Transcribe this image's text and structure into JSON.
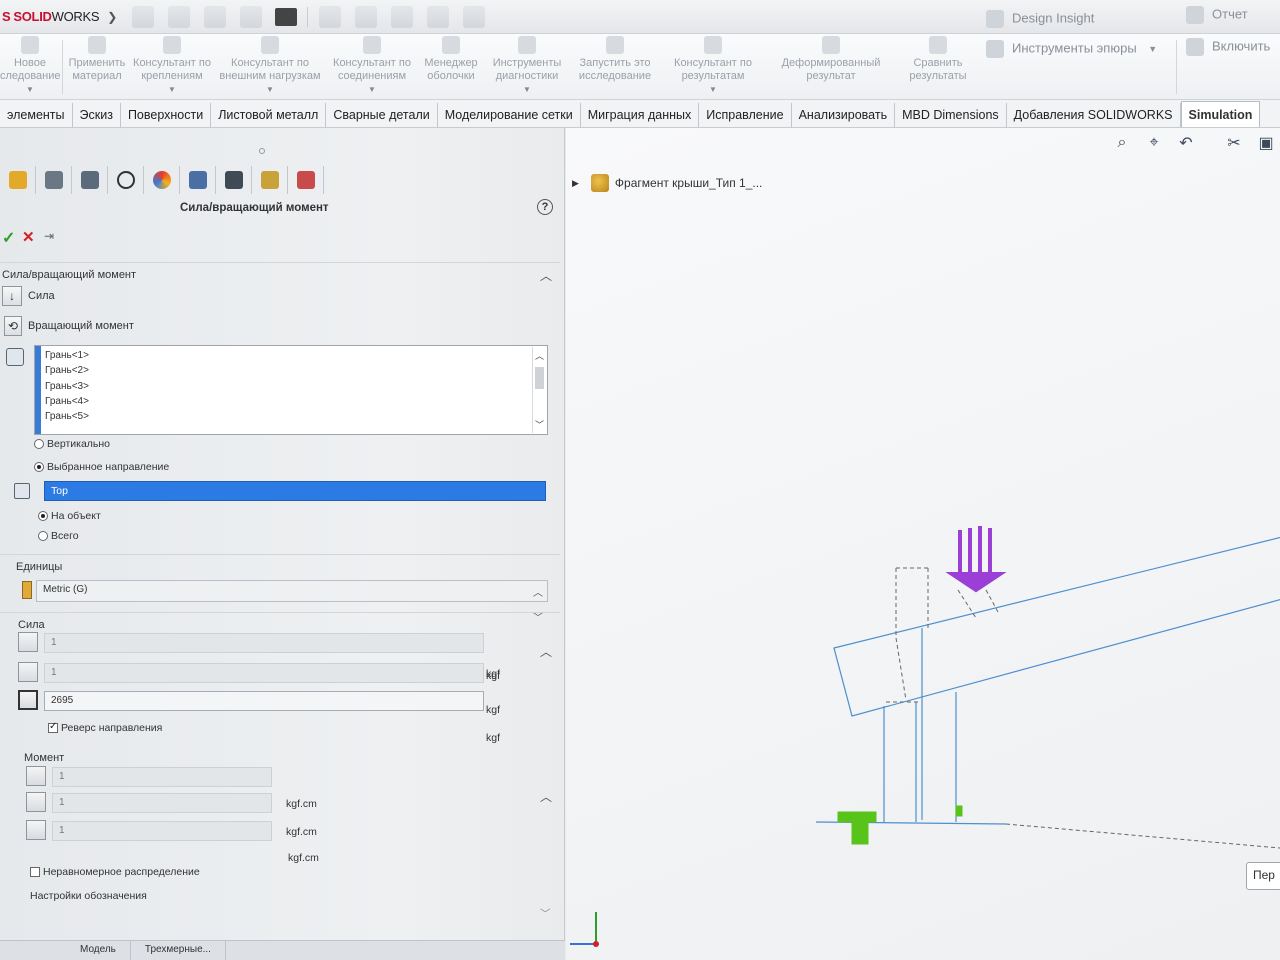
{
  "app": {
    "brand_prefix": "S",
    "brand_solid": "SOLID",
    "brand_works": "WORKS"
  },
  "ribbon": {
    "items": [
      {
        "label": "Новое\nследование"
      },
      {
        "label": "Применить\nматериал"
      },
      {
        "label": "Консультант по\nкреплениям"
      },
      {
        "label": "Консультант по\nвнешним нагрузкам"
      },
      {
        "label": "Консультант по\nсоединениям"
      },
      {
        "label": "Менеджер\nоболочки"
      },
      {
        "label": "Инструменты\nдиагностики"
      },
      {
        "label": "Запустить это\nисследование"
      },
      {
        "label": "Консультант по\nрезультатам"
      },
      {
        "label": "Деформированный\nрезультат"
      },
      {
        "label": "Сравнить\nрезультаты"
      }
    ],
    "design_insight": "Design Insight",
    "plot_tools": "Инструменты эпюры",
    "report": "Отчет",
    "include": "Включить"
  },
  "tabs": [
    {
      "label": "элементы"
    },
    {
      "label": "Эскиз"
    },
    {
      "label": "Поверхности"
    },
    {
      "label": "Листовой металл"
    },
    {
      "label": "Сварные детали"
    },
    {
      "label": "Моделирование сетки"
    },
    {
      "label": "Миграция данных"
    },
    {
      "label": "Исправление"
    },
    {
      "label": "Анализировать"
    },
    {
      "label": "MBD Dimensions"
    },
    {
      "label": "Добавления SOLIDWORKS"
    },
    {
      "label": "Simulation"
    }
  ],
  "property_manager": {
    "title": "Сила/вращающий момент",
    "help": "?",
    "group_force_torque": "Сила/вращающий момент",
    "opt_force": "Сила",
    "opt_torque": "Вращающий момент",
    "faces": [
      "Грань<1>",
      "Грань<2>",
      "Грань<3>",
      "Грань<4>",
      "Грань<5>"
    ],
    "radio_normal": "Вертикально",
    "radio_selected_dir": "Выбранное направление",
    "direction_ref": "Top",
    "radio_per_item": "На объект",
    "radio_total": "Всего",
    "units_label": "Единицы",
    "units_value": "Metric (G)",
    "force_label": "Сила",
    "force_fields": [
      {
        "value": "1",
        "unit": "kgf"
      },
      {
        "value": "1",
        "unit": "kgf"
      },
      {
        "value": "2695",
        "unit": "kgf"
      }
    ],
    "reverse_direction": "Реверс направления",
    "reverse_unit": "kgf",
    "moment_label": "Момент",
    "moment_fields": [
      {
        "value": "1",
        "unit": "kgf.cm"
      },
      {
        "value": "1",
        "unit": "kgf.cm"
      },
      {
        "value": "1",
        "unit": "kgf.cm"
      }
    ],
    "nonuniform": "Неравномерное распределение",
    "symbol_settings": "Настройки обозначения"
  },
  "bottom_tabs": [
    {
      "label": "Модель"
    },
    {
      "label": "Трехмерные..."
    }
  ],
  "graphics": {
    "tree_root": "Фрагмент крыши_Тип 1_...",
    "side_button": "Пер"
  },
  "colors": {
    "accent": "#2c7be5",
    "load_arrow": "#9b3fd6",
    "fixture": "#58c41a",
    "model_edge": "#4d8fcf"
  }
}
